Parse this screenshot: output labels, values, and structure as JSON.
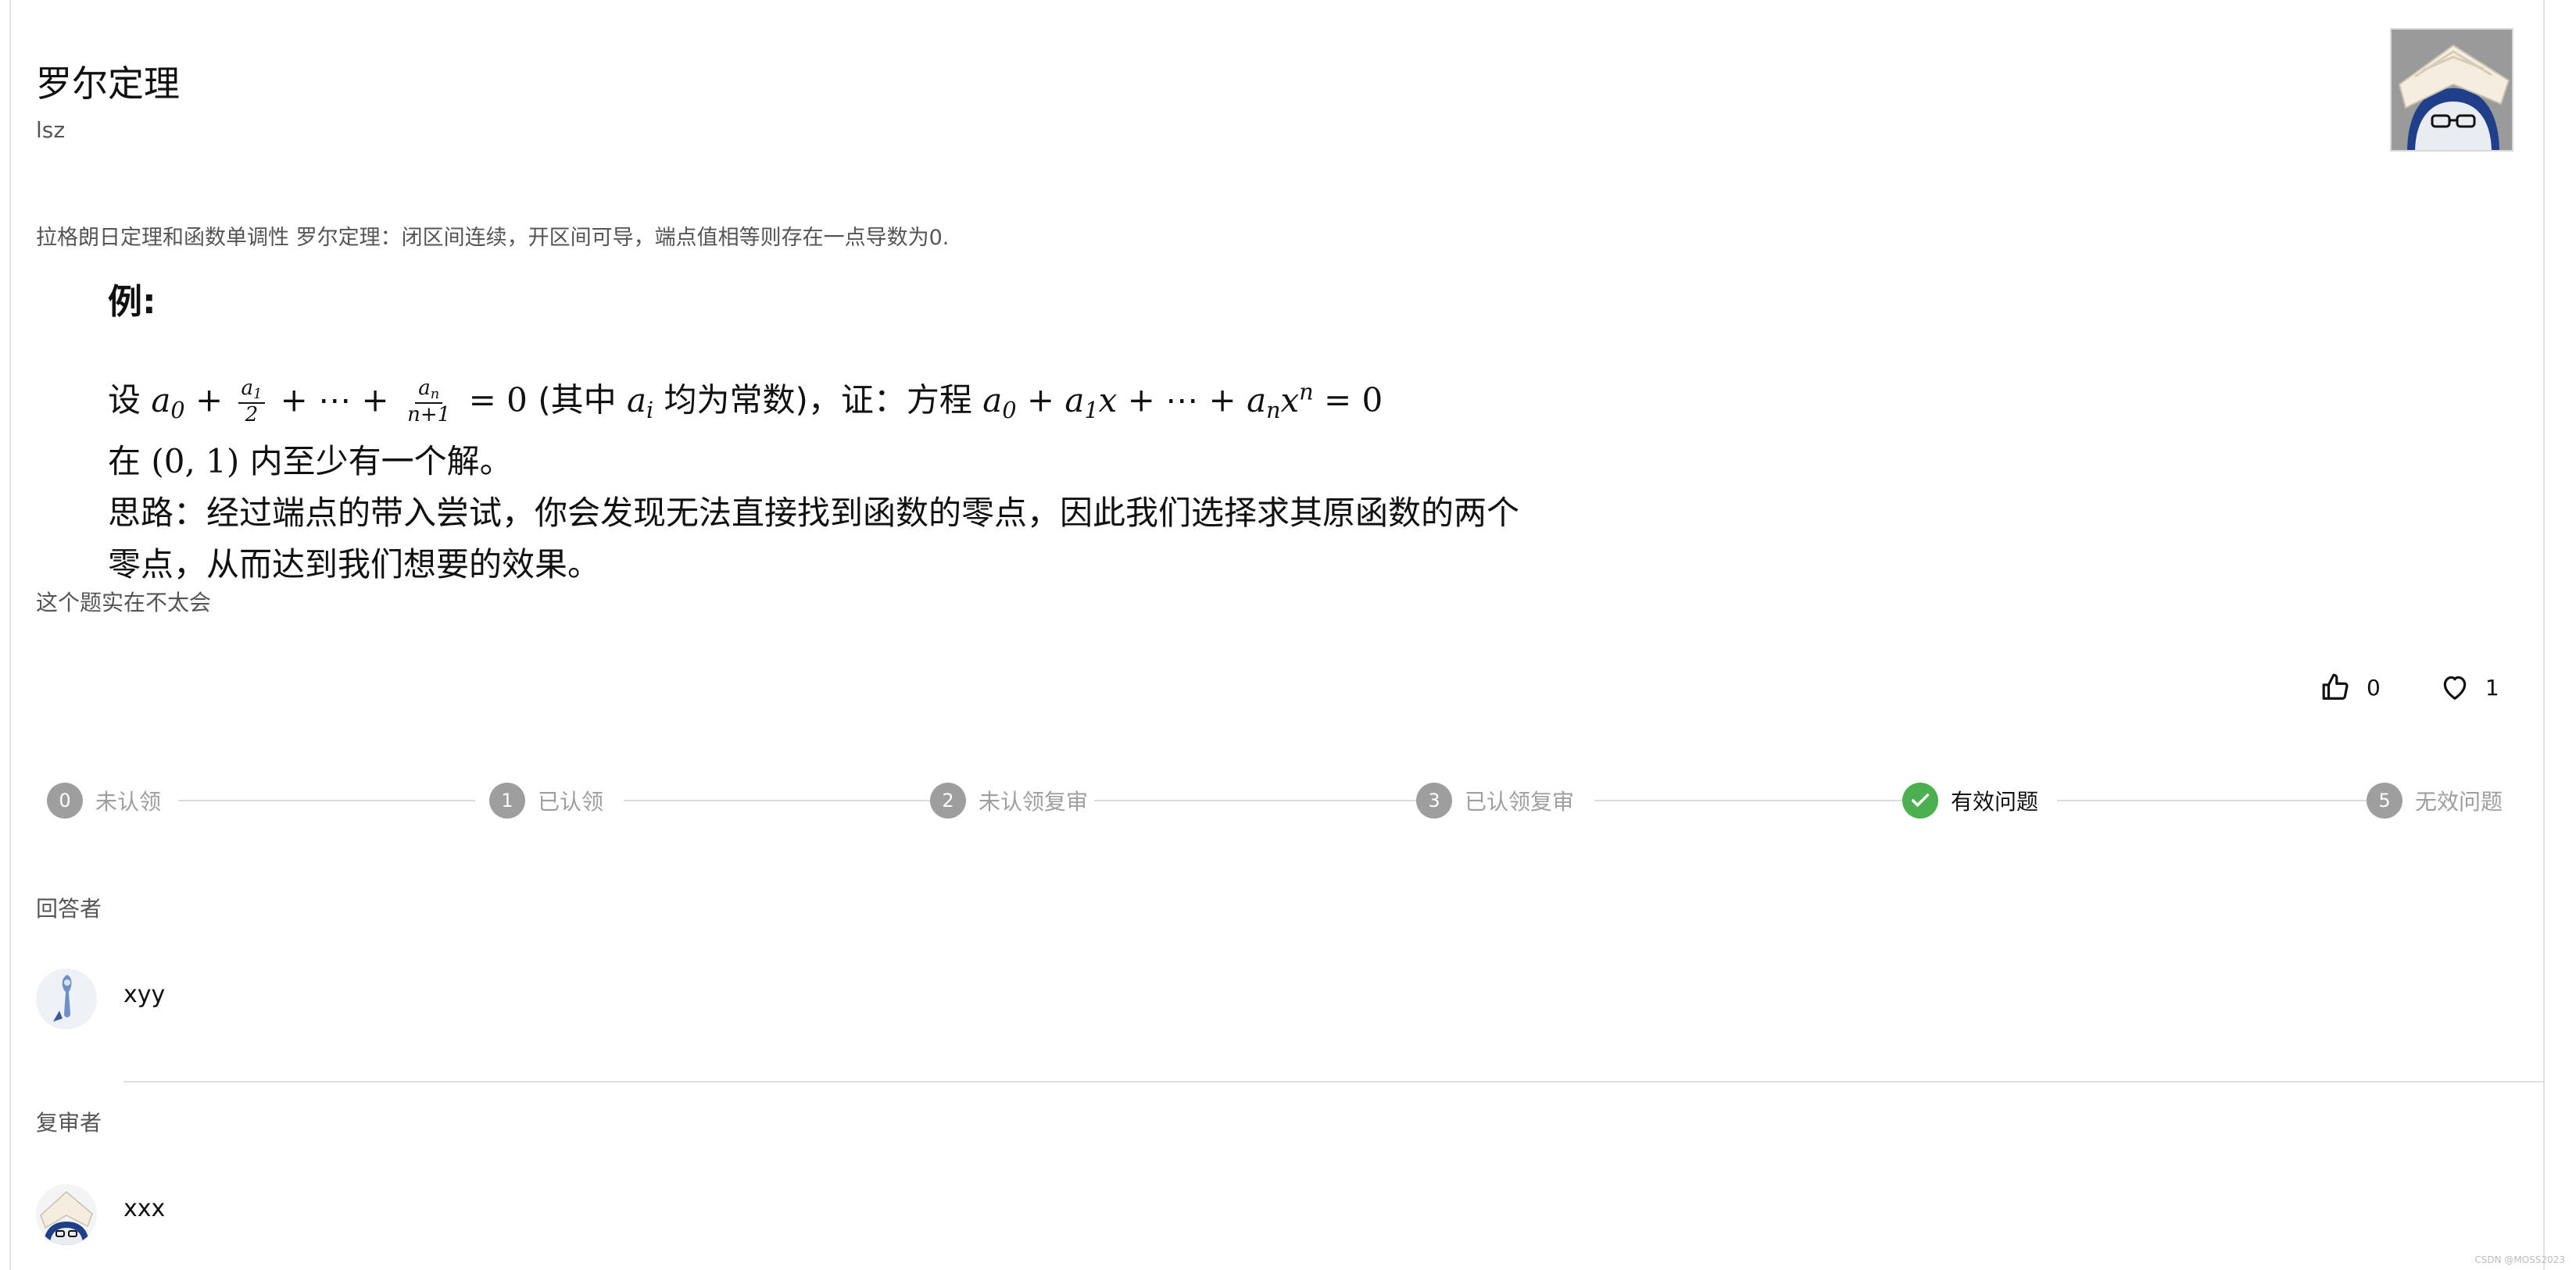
{
  "question": {
    "title": "罗尔定理",
    "author": "lsz",
    "description": "拉格朗日定理和函数单调性 罗尔定理：闭区间连续，开区间可导，端点值相等则存在一点导数为0.",
    "problem": {
      "heading": "例:",
      "line1_prefix": "设",
      "line1_middle": "(其中",
      "line1_const": "均为常数)，证：方程",
      "line2_prefix": "在",
      "line2_suffix": "内至少有一个解。",
      "line3": "思路：经过端点的带入尝试，你会发现无法直接找到函数的零点，因此我们选择求其原函数的两个",
      "line4": "零点，从而达到我们想要的效果。"
    },
    "note": "这个题实在不太会"
  },
  "reactions": {
    "likes": "0",
    "favorites": "1"
  },
  "steps": [
    {
      "index": "0",
      "label": "未认领",
      "state": "pending"
    },
    {
      "index": "1",
      "label": "已认领",
      "state": "pending"
    },
    {
      "index": "2",
      "label": "未认领复审",
      "state": "pending"
    },
    {
      "index": "3",
      "label": "已认领复审",
      "state": "pending"
    },
    {
      "index": "4",
      "label": "有效问题",
      "state": "completed"
    },
    {
      "index": "5",
      "label": "无效问题",
      "state": "pending"
    }
  ],
  "answerer": {
    "section_label": "回答者",
    "name": "xyy"
  },
  "reviewer": {
    "section_label": "复审者",
    "name": "xxx"
  },
  "watermark": "CSDN @MOSS2023",
  "colors": {
    "step_done": "#4caf50",
    "step_pending": "#9e9e9e",
    "muted_text": "#555555"
  }
}
